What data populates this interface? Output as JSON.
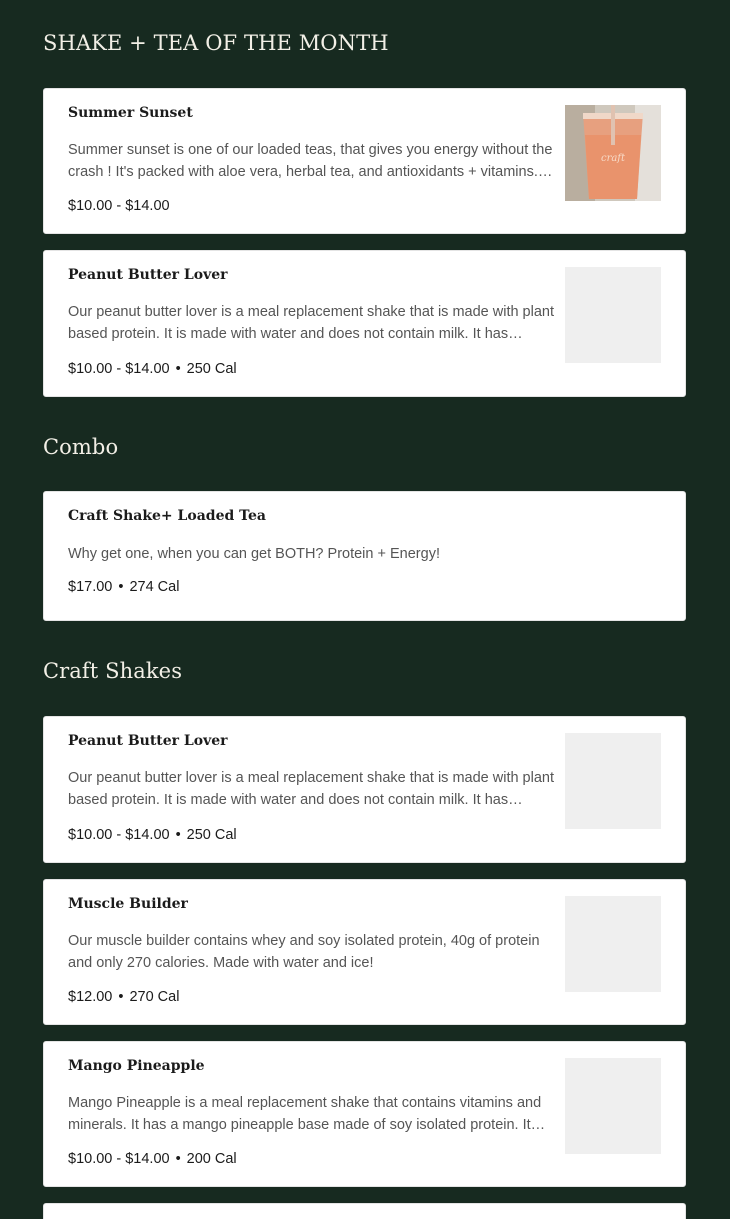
{
  "sections": {
    "featured_title": "SHAKE + TEA OF THE MONTH",
    "combo_title": "Combo",
    "shakes_title": "Craft Shakes"
  },
  "featured": [
    {
      "name": "Summer Sunset",
      "description": "Summer sunset is one of our loaded teas, that gives you energy without the crash ! It's packed with aloe vera, herbal tea, and antioxidants + vitamins. It'...",
      "price": "$10.00 - $14.00",
      "image": "loaded-tea-cup-photo"
    },
    {
      "name": "Peanut Butter Lover",
      "description": "Our peanut butter lover is a meal replacement shake that is made with plant based protein. It is made with water and does not contain milk. It has dulce...",
      "price": "$10.00 - $14.00",
      "calories": "250 Cal"
    }
  ],
  "combo": [
    {
      "name": "Craft Shake+ Loaded Tea",
      "description": "Why get one, when you can get BOTH? Protein + Energy!",
      "price": "$17.00",
      "calories": "274 Cal"
    }
  ],
  "shakes": [
    {
      "name": "Peanut Butter Lover",
      "description": "Our peanut butter lover is a meal replacement shake that is made with plant based protein. It is made with water and does not contain milk. It has dulce...",
      "price": "$10.00 - $14.00",
      "calories": "250 Cal"
    },
    {
      "name": "Muscle Builder",
      "description": "Our muscle builder contains whey and soy isolated protein, 40g of protein and only 270 calories. Made with water and ice!",
      "price": "$12.00",
      "calories": "270 Cal"
    },
    {
      "name": "Mango Pineapple",
      "description": "Mango Pineapple is a meal replacement shake that contains vitamins and minerals. It has a mango pineapple base made of soy isolated protein. It is...",
      "price": "$10.00 - $14.00",
      "calories": "200 Cal"
    }
  ],
  "separator": "•",
  "colors": {
    "page_background": "#172a20",
    "card_background": "#ffffff",
    "heading": "#f2efe6",
    "placeholder_image": "#efefef"
  }
}
